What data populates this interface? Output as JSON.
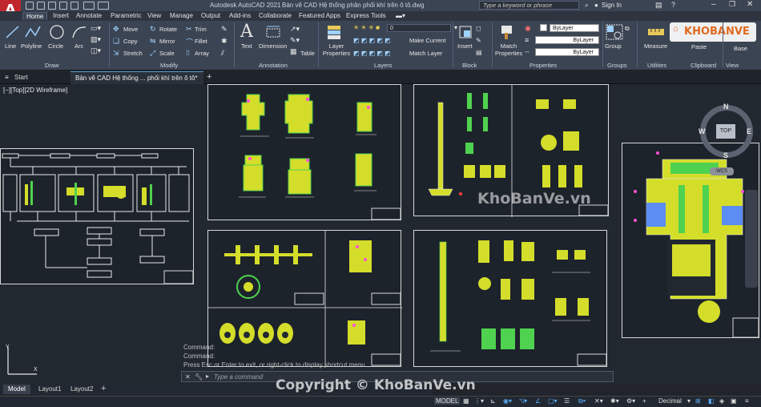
{
  "app": {
    "title": "Autodesk AutoCAD 2021",
    "file_title": "Bản vẽ CAD Hệ thống phân phối khí trên ô tô.dwg",
    "logo_letter": "A",
    "search_placeholder": "Type a keyword or phrase",
    "sign_in": "Sign In"
  },
  "ribbon_tabs": [
    "Home",
    "Insert",
    "Annotate",
    "Parametric",
    "View",
    "Manage",
    "Output",
    "Add-ins",
    "Collaborate",
    "Featured Apps",
    "Express Tools"
  ],
  "ribbon": {
    "draw": {
      "line": "Line",
      "polyline": "Polyline",
      "circle": "Circle",
      "arc": "Arc",
      "panel": "Draw"
    },
    "modify": {
      "move": "Move",
      "rotate": "Rotate",
      "trim": "Trim",
      "copy": "Copy",
      "mirror": "Mirror",
      "fillet": "Fillet",
      "stretch": "Stretch",
      "scale": "Scale",
      "array": "Array",
      "panel": "Modify"
    },
    "annotation": {
      "text": "Text",
      "dimension": "Dimension",
      "table": "Table",
      "panel": "Annotation"
    },
    "layers": {
      "layer_properties": "Layer Properties",
      "current_layer": "0",
      "make_current": "Make Current",
      "match_layer": "Match Layer",
      "panel": "Layers"
    },
    "block": {
      "insert": "Insert",
      "panel": "Block"
    },
    "properties": {
      "match": "Match Properties",
      "bylayer1": "ByLayer",
      "bylayer2": "ByLayer",
      "bylayer3": "ByLayer",
      "panel": "Properties"
    },
    "groups": {
      "group": "Group",
      "panel": "Groups"
    },
    "utilities": {
      "measure": "Measure",
      "panel": "Utilities"
    },
    "clipboard": {
      "paste": "Paste",
      "panel": "Clipboard"
    },
    "view": {
      "base": "Base",
      "panel": "View"
    }
  },
  "doc_tabs": {
    "start": "Start",
    "drawing": "Bản vẽ CAD Hệ thống ... phối khí trên ô tô*"
  },
  "viewport_label": "[−][Top][2D Wireframe]",
  "viewcube": {
    "n": "N",
    "s": "S",
    "e": "E",
    "w": "W",
    "top": "TOP",
    "wcs": "WCS"
  },
  "command": {
    "line1": "Command:",
    "line2": "Command:",
    "line3": "Press Esc or Enter to exit, or right-click to display shortcut menu.",
    "placeholder": "Type a command"
  },
  "layout_tabs": [
    "Model",
    "Layout1",
    "Layout2"
  ],
  "status": {
    "model": "MODEL",
    "units": "Decimal"
  },
  "watermarks": {
    "brand_logo": "KHOBANVE",
    "center": "KhoBanVe.vn",
    "bottom": "Copyright © KhoBanVe.vn"
  },
  "colors": {
    "accent": "#d4dd2a",
    "brand_red": "#c0272d",
    "sheet_border": "#d8d8d8"
  }
}
